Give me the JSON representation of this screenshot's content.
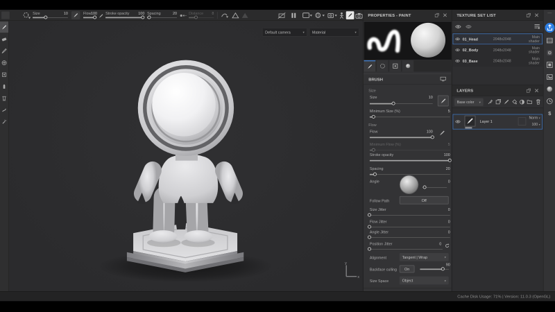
{
  "topbar": {
    "size_label": "Size",
    "size_value": "10",
    "flow_label": "Flow",
    "flow_value": "100",
    "stroke_opacity_label": "Stroke opacity",
    "stroke_opacity_value": "100",
    "spacing_label": "Spacing",
    "spacing_value": "20",
    "distance_label": "Distance",
    "distance_value": "8"
  },
  "viewport": {
    "camera_select": "Default camera",
    "shading_select": "Material",
    "gizmo_x": "x",
    "gizmo_y": "y"
  },
  "properties": {
    "title": "PROPERTIES - PAINT",
    "section_title": "BRUSH",
    "size_group": "Size",
    "flow_group": "Flow",
    "rows": {
      "size": {
        "label": "Size",
        "value": "10"
      },
      "min_size": {
        "label": "Minimum Size (%)",
        "value": "5"
      },
      "flow": {
        "label": "Flow",
        "value": "100"
      },
      "min_flow": {
        "label": "Minimum Flow (%)",
        "value": "5"
      },
      "stroke_opacity": {
        "label": "Stroke opacity",
        "value": "100"
      },
      "spacing": {
        "label": "Spacing",
        "value": "20"
      },
      "angle": {
        "label": "Angle",
        "value": "0"
      },
      "follow_path": {
        "label": "Follow Path",
        "value": "Off"
      },
      "size_jitter": {
        "label": "Size Jitter",
        "value": "0"
      },
      "flow_jitter": {
        "label": "Flow Jitter",
        "value": "0"
      },
      "angle_jitter": {
        "label": "Angle Jitter",
        "value": "0"
      },
      "position_jitter": {
        "label": "Position Jitter",
        "value": "0"
      },
      "alignment": {
        "label": "Alignment",
        "value": "Tangent | Wrap"
      },
      "backface": {
        "label": "Backface culling",
        "value": "On",
        "amount": "90"
      },
      "size_space": {
        "label": "Size Space",
        "value": "Object"
      }
    }
  },
  "texture_sets": {
    "title": "TEXTURE SET LIST",
    "rows": [
      {
        "name": "01_Head",
        "resolution": "2048x2048",
        "shader": "Main shader"
      },
      {
        "name": "02_Body",
        "resolution": "2048x2048",
        "shader": "Main shader"
      },
      {
        "name": "03_Base",
        "resolution": "2048x2048",
        "shader": "Main shader"
      }
    ]
  },
  "layers": {
    "title": "LAYERS",
    "channel": "Base color",
    "layer_name": "Layer 1",
    "blend_mode": "Norm",
    "opacity": "100"
  },
  "status": {
    "text": "Cache Disk Usage:   71% | Version: 11.0.3 (OpenGL)"
  },
  "colors": {
    "accent_blue": "#2f7fe0",
    "selection_border": "#3d6fb4"
  }
}
